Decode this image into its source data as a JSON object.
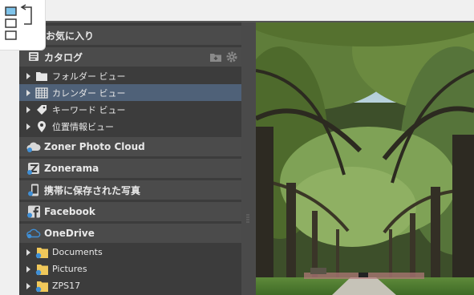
{
  "sidebar": {
    "favorites": "お気に入り",
    "catalog": "カタログ",
    "catalog_items": [
      "フォルダー ビュー",
      "カレンダー ビュー",
      "キーワード ビュー",
      "位置情報ビュー"
    ],
    "zoner_cloud": "Zoner Photo Cloud",
    "zonerama": "Zonerama",
    "mobile": "携帯に保存された写真",
    "facebook": "Facebook",
    "onedrive": "OneDrive",
    "onedrive_items": [
      "Documents",
      "Pictures",
      "ZPS17"
    ]
  },
  "colors": {
    "panel": "#3c3c3c",
    "header": "#4b4b4b",
    "selected": "#4f6178",
    "accent": "#3f8fd6"
  }
}
